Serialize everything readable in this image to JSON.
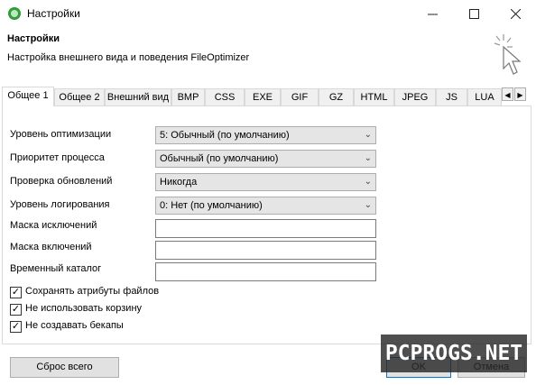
{
  "window": {
    "title": "Настройки",
    "minimize_icon": "minimize-icon",
    "maximize_icon": "maximize-icon",
    "close_icon": "close-icon"
  },
  "header": {
    "title": "Настройки",
    "subtitle": "Настройка внешнего вида и поведения FileOptimizer"
  },
  "tabs": [
    {
      "label": "Общее 1",
      "active": true
    },
    {
      "label": "Общее 2"
    },
    {
      "label": "Внешний вид"
    },
    {
      "label": "BMP"
    },
    {
      "label": "CSS"
    },
    {
      "label": "EXE"
    },
    {
      "label": "GIF"
    },
    {
      "label": "GZ"
    },
    {
      "label": "HTML"
    },
    {
      "label": "JPEG"
    },
    {
      "label": "JS"
    },
    {
      "label": "LUA"
    }
  ],
  "tab_scroll": {
    "left": "◀",
    "right": "▶"
  },
  "settings": {
    "optimization_level": {
      "label": "Уровень оптимизации",
      "value": "5: Обычный (по умолчанию)"
    },
    "process_priority": {
      "label": "Приоритет процесса",
      "value": "Обычный (по умолчанию)"
    },
    "check_updates": {
      "label": "Проверка обновлений",
      "value": "Никогда"
    },
    "log_level": {
      "label": "Уровень логирования",
      "value": "0: Нет (по умолчанию)"
    },
    "exclude_mask": {
      "label": "Маска исключений",
      "value": ""
    },
    "include_mask": {
      "label": "Маска включений",
      "value": ""
    },
    "temp_dir": {
      "label": "Временный каталог",
      "value": ""
    }
  },
  "checkboxes": [
    {
      "label": "Сохранять атрибуты файлов",
      "checked": true
    },
    {
      "label": "Не использовать корзину",
      "checked": true
    },
    {
      "label": "Не создавать бекапы",
      "checked": true
    }
  ],
  "buttons": {
    "reset": "Сброс всего",
    "ok": "OK",
    "cancel": "Отмена"
  },
  "watermark": "PCPROGS.NET",
  "colors": {
    "app_icon": "#2e9d3a",
    "default_button_border": "#0078d7"
  }
}
